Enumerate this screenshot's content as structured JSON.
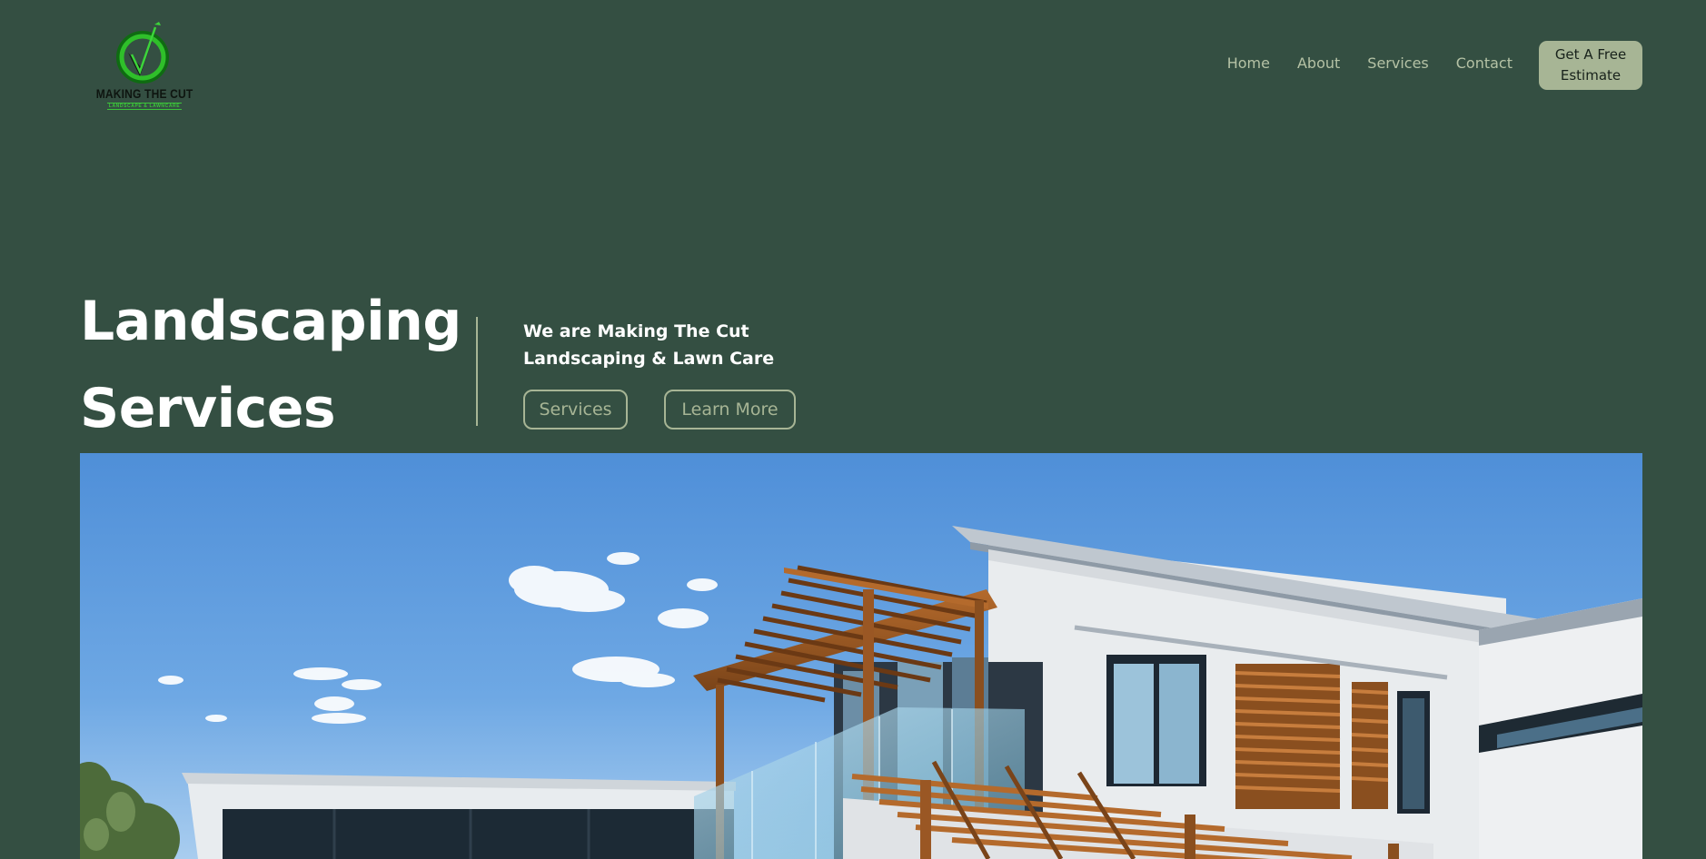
{
  "brand": {
    "name": "MAKING THE CUT",
    "tagline": "LANDSCAPE & LAWNCARE",
    "logo_icon": "checkmark-circle-icon",
    "accent_color": "#2fbf2a"
  },
  "nav": {
    "items": [
      {
        "label": "Home"
      },
      {
        "label": "About"
      },
      {
        "label": "Services"
      },
      {
        "label": "Contact"
      }
    ],
    "cta": {
      "line1": "Get A Free",
      "line2": "Estimate"
    }
  },
  "hero": {
    "title_line1": "Landscaping",
    "title_line2": "Services",
    "subtitle_line1": "We are Making The Cut",
    "subtitle_line2": "Landscaping & Lawn Care",
    "buttons": {
      "services": "Services",
      "learn_more": "Learn More"
    }
  },
  "colors": {
    "background": "#344f42",
    "sage": "#a7b595",
    "nav_text": "#b5c2a5",
    "heading": "#ffffff"
  }
}
